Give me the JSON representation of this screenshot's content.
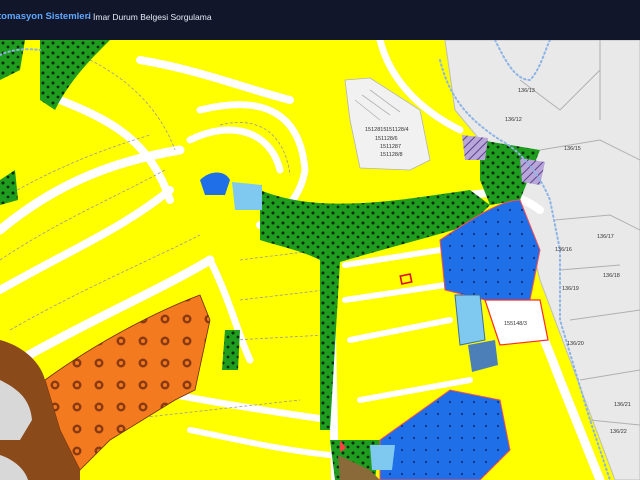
{
  "header": {
    "app_title": "tomasyon Sistemleri",
    "separator": "-",
    "page_title": "İmar Durum Belgesi Sorgulama"
  },
  "map": {
    "colors": {
      "residential": "#ffff00",
      "green": "#1f9d1f",
      "commercial": "#1e6fe8",
      "light_blue": "#7fc9f0",
      "orange": "#f47a20",
      "brown": "#8b4a1a",
      "existing": "#e9e9e9",
      "road": "#ffffff",
      "outline": "#ff2a2a"
    },
    "parcel_labels": [
      "136/13",
      "136/12",
      "136/15",
      "136/16",
      "136/17",
      "136/18",
      "136/19",
      "136/20",
      "136/21",
      "136/22",
      "155148/3",
      "1512815",
      "151128/4",
      "151128/6",
      "1511287",
      "151128/8"
    ]
  }
}
